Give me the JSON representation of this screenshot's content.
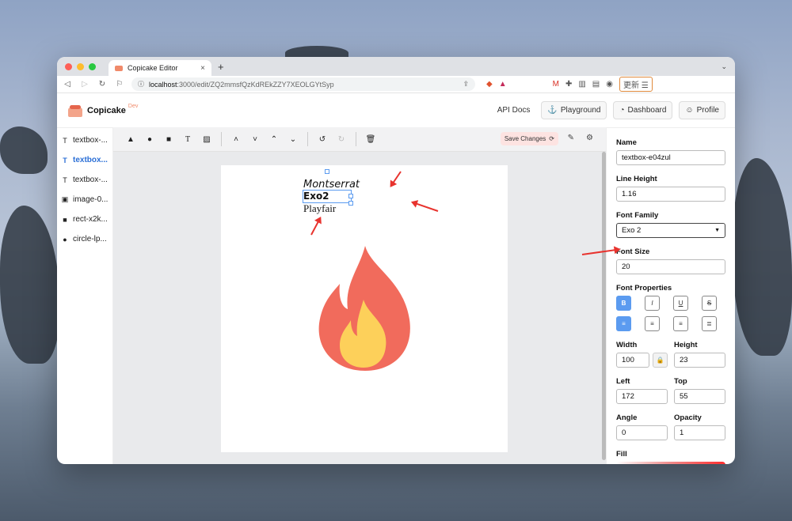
{
  "browser": {
    "tab_title": "Copicake Editor",
    "tab_close": "×",
    "new_tab": "+",
    "tab_menu": "⌄",
    "url_host": "localhost",
    "url_path": ":3000/edit/ZQ2mmsfQzKdREkZZY7XEOLGYtSyp",
    "update_label": "更新"
  },
  "app": {
    "brand": "Copicake",
    "brand_tag": "Dev",
    "nav": {
      "api_docs": "API Docs",
      "playground": "Playground",
      "dashboard": "Dashboard",
      "profile": "Profile"
    }
  },
  "layers": [
    {
      "icon": "T",
      "label": "textbox-...",
      "active": false
    },
    {
      "icon": "T",
      "label": "textbox...",
      "active": true
    },
    {
      "icon": "T",
      "label": "textbox-...",
      "active": false
    },
    {
      "icon": "▣",
      "label": "image-0...",
      "active": false
    },
    {
      "icon": "■",
      "label": "rect-x2k...",
      "active": false
    },
    {
      "icon": "●",
      "label": "circle-lp...",
      "active": false
    }
  ],
  "toolbar": {
    "text_tool": "T",
    "save_label": "Save Changes"
  },
  "canvas": {
    "texts": [
      "Montserrat",
      "Exo2",
      "Playfair"
    ]
  },
  "properties": {
    "name_label": "Name",
    "name_value": "textbox-e04zul",
    "line_height_label": "Line Height",
    "line_height_value": "1.16",
    "font_family_label": "Font Family",
    "font_family_value": "Exo 2",
    "font_size_label": "Font Size",
    "font_size_value": "20",
    "font_props_label": "Font Properties",
    "bold": "B",
    "italic": "I",
    "underline": "U",
    "strike": "S",
    "width_label": "Width",
    "width_value": "100",
    "height_label": "Height",
    "height_value": "23",
    "left_label": "Left",
    "left_value": "172",
    "top_label": "Top",
    "top_value": "55",
    "angle_label": "Angle",
    "angle_value": "0",
    "opacity_label": "Opacity",
    "opacity_value": "1",
    "fill_label": "Fill"
  },
  "colors": {
    "accent": "#5b9bf0",
    "flame_outer": "#f16b5c",
    "flame_inner": "#fdd05a",
    "annotation_arrow": "#e8332e"
  }
}
